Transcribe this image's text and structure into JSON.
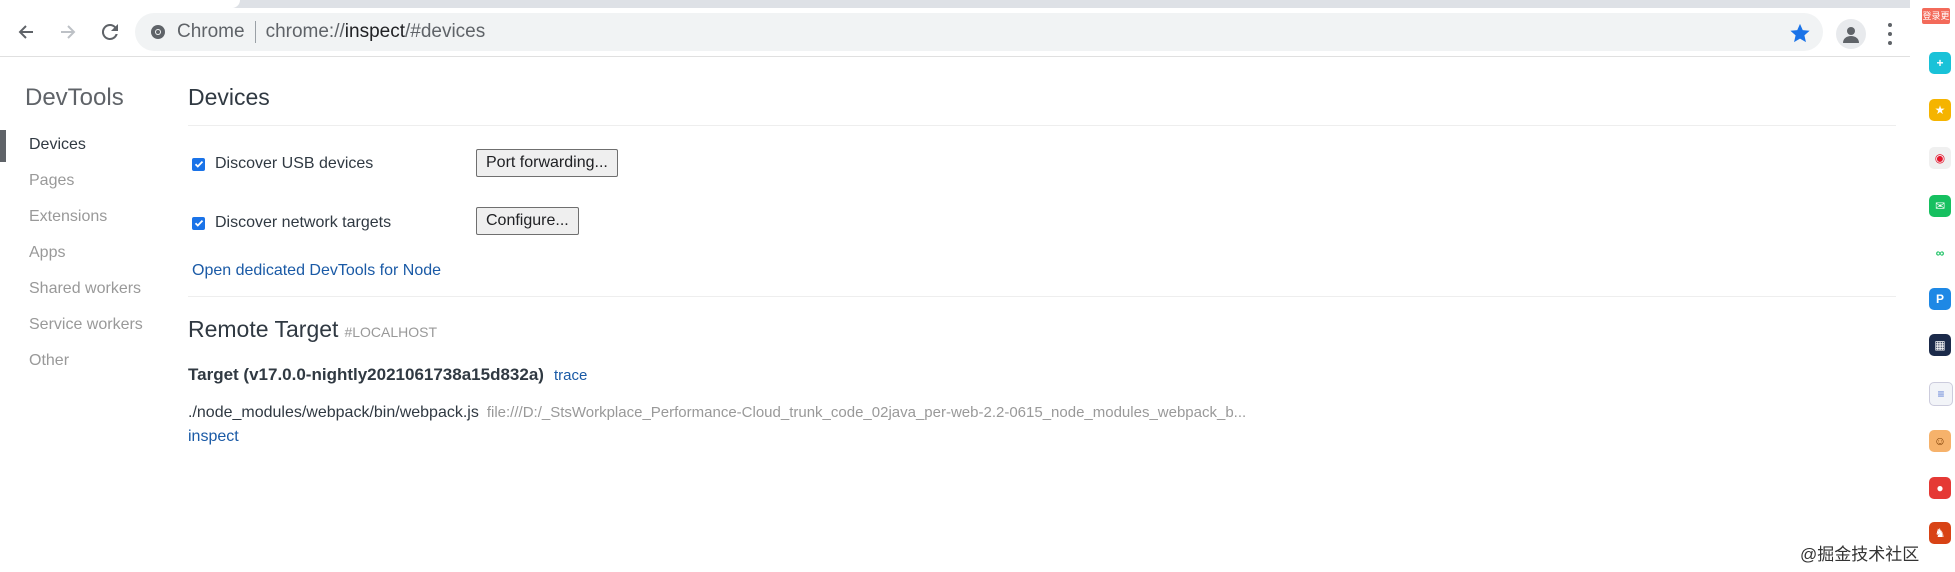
{
  "browser": {
    "chip_label": "Chrome",
    "url_prefix": "chrome://",
    "url_host": "inspect",
    "url_rest": "/#devices"
  },
  "nav": {
    "title": "DevTools",
    "items": [
      {
        "label": "Devices"
      },
      {
        "label": "Pages"
      },
      {
        "label": "Extensions"
      },
      {
        "label": "Apps"
      },
      {
        "label": "Shared workers"
      },
      {
        "label": "Service workers"
      },
      {
        "label": "Other"
      }
    ]
  },
  "devices": {
    "title": "Devices",
    "usb_label": "Discover USB devices",
    "usb_checked": true,
    "port_forwarding_button": "Port forwarding...",
    "network_label": "Discover network targets",
    "network_checked": true,
    "configure_button": "Configure...",
    "node_link": "Open dedicated DevTools for Node"
  },
  "remote": {
    "title": "Remote Target",
    "subtitle": "#LOCALHOST",
    "target_name": "Target (v17.0.0-nightly2021061738a15d832a)",
    "trace_link": "trace",
    "path": "./node_modules/webpack/bin/webpack.js",
    "file_url": "file:///D:/_StsWorkplace_Performance-Cloud_trunk_code_02java_per-web-2.2-0615_node_modules_webpack_b...",
    "inspect_link": "inspect"
  },
  "side": {
    "badge": "登录更新",
    "icons": [
      "plus-icon",
      "star-icon",
      "weibo-icon",
      "mail-icon",
      "cloud-icon",
      "p-icon",
      "qr-icon",
      "doc-icon",
      "face-icon",
      "red-app-icon",
      "game-icon"
    ]
  },
  "watermark": "@掘金技术社区"
}
